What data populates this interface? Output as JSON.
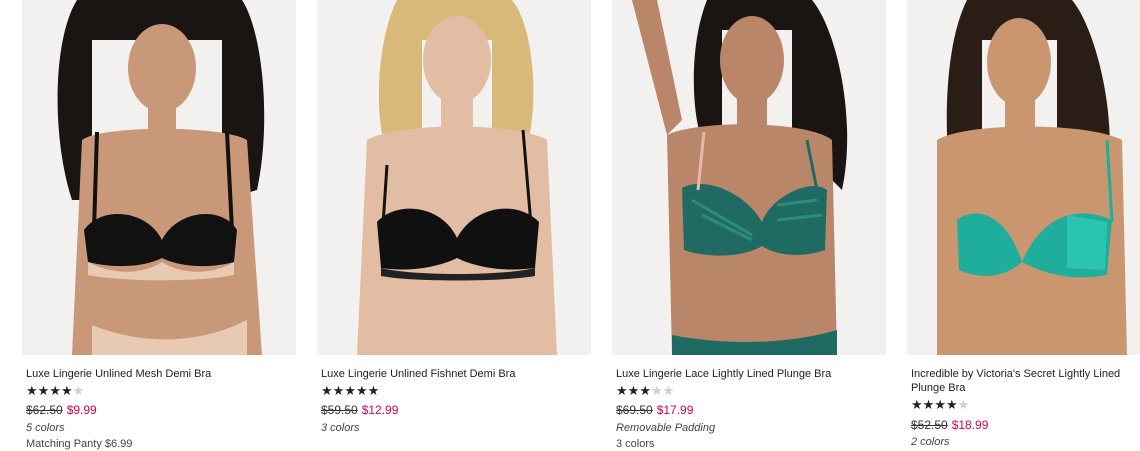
{
  "products": [
    {
      "name": "Luxe Lingerie Unlined Mesh Demi Bra",
      "rating_stars": 3.5,
      "old_price": "$62.50",
      "sale_price": "$9.99",
      "note": "5 colors",
      "note2": "Matching Panty $6.99",
      "colors": {
        "bra": "#111111",
        "accent": "#e8c9b3",
        "hair": "#1a1512",
        "skin": "#c89878"
      }
    },
    {
      "name": "Luxe Lingerie Unlined Fishnet Demi Bra",
      "rating_stars": 4.5,
      "old_price": "$59.50",
      "sale_price": "$12.99",
      "note": "3 colors",
      "note2": "",
      "colors": {
        "bra": "#101010",
        "accent": "#3a3a3a",
        "hair": "#d8b97a",
        "skin": "#e2bda3"
      }
    },
    {
      "name": "Luxe Lingerie Lace Lightly Lined Plunge Bra",
      "rating_stars": 3,
      "old_price": "$69.50",
      "sale_price": "$17.99",
      "note": "Removable Padding",
      "note2": "3 colors",
      "colors": {
        "bra": "#1f6b63",
        "accent": "#2f8a80",
        "hair": "#1a1512",
        "skin": "#b9866a"
      }
    },
    {
      "name": "Incredible by Victoria's Secret Lightly Lined Plunge Bra",
      "rating_stars": 4,
      "old_price": "$52.50",
      "sale_price": "$18.99",
      "note": "2 colors",
      "note2": "",
      "colors": {
        "bra": "#1fae9c",
        "accent": "#2bc4b0",
        "hair": "#2a1d16",
        "skin": "#c9966f"
      }
    }
  ]
}
